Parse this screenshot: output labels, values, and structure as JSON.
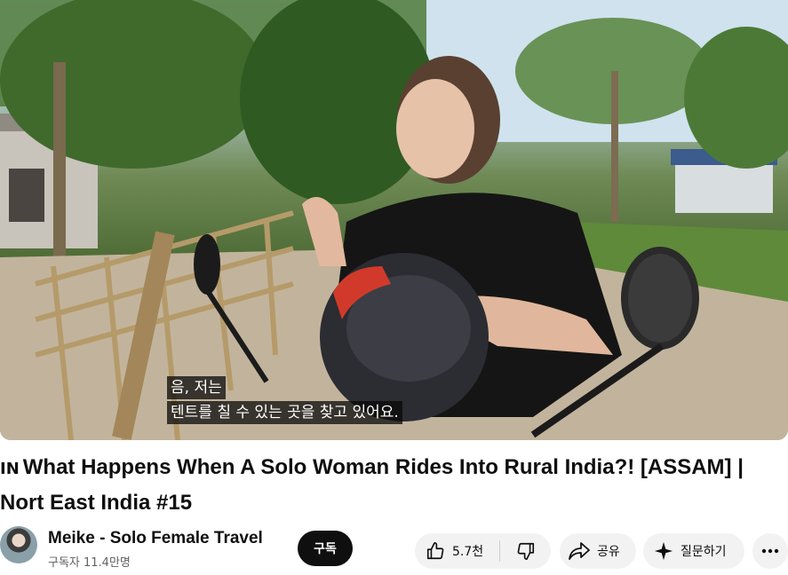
{
  "video": {
    "subtitle_lines": [
      "음, 저는",
      "텐트를 칠 수 있는 곳을 찾고 있어요."
    ]
  },
  "title": {
    "prefix": "IN",
    "text": "What Happens When A Solo Woman Rides Into Rural India?! [ASSAM] | Nort East India #15"
  },
  "channel": {
    "name": "Meike - Solo Female Travel",
    "subscribers": "구독자 11.4만명",
    "subscribe_label": "구독"
  },
  "actions": {
    "like_count": "5.7천",
    "share_label": "공유",
    "ask_label": "질문하기"
  },
  "icons": {
    "like": "thumbs-up-icon",
    "dislike": "thumbs-down-icon",
    "share": "share-arrow-icon",
    "ask": "sparkle-icon",
    "more": "more-horizontal-icon"
  }
}
